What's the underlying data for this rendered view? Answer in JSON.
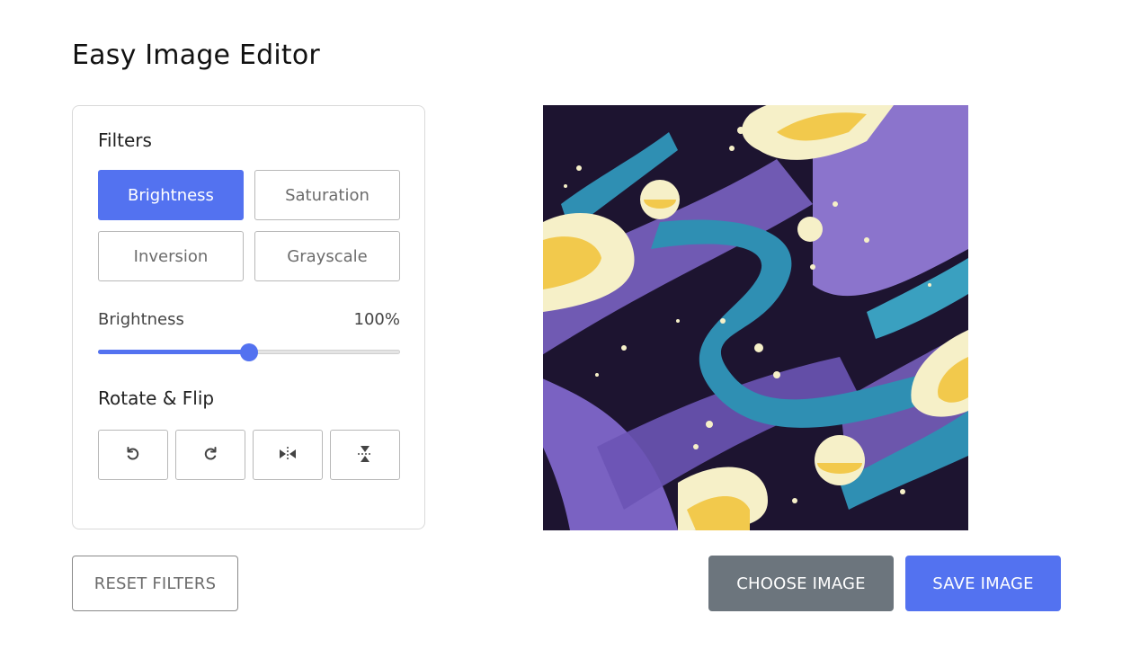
{
  "app": {
    "title": "Easy Image Editor"
  },
  "filters": {
    "heading": "Filters",
    "buttons": [
      {
        "label": "Brightness",
        "active": true
      },
      {
        "label": "Saturation",
        "active": false
      },
      {
        "label": "Inversion",
        "active": false
      },
      {
        "label": "Grayscale",
        "active": false
      }
    ],
    "slider": {
      "name": "Brightness",
      "value_text": "100%",
      "value": 100,
      "max": 200
    }
  },
  "rotate": {
    "heading": "Rotate & Flip",
    "icons": [
      "rotate-left-icon",
      "rotate-right-icon",
      "flip-horizontal-icon",
      "flip-vertical-icon"
    ]
  },
  "actions": {
    "reset": "RESET FILTERS",
    "choose": "CHOOSE IMAGE",
    "save": "SAVE IMAGE"
  },
  "colors": {
    "accent": "#5372F0",
    "secondary": "#6C757D"
  }
}
